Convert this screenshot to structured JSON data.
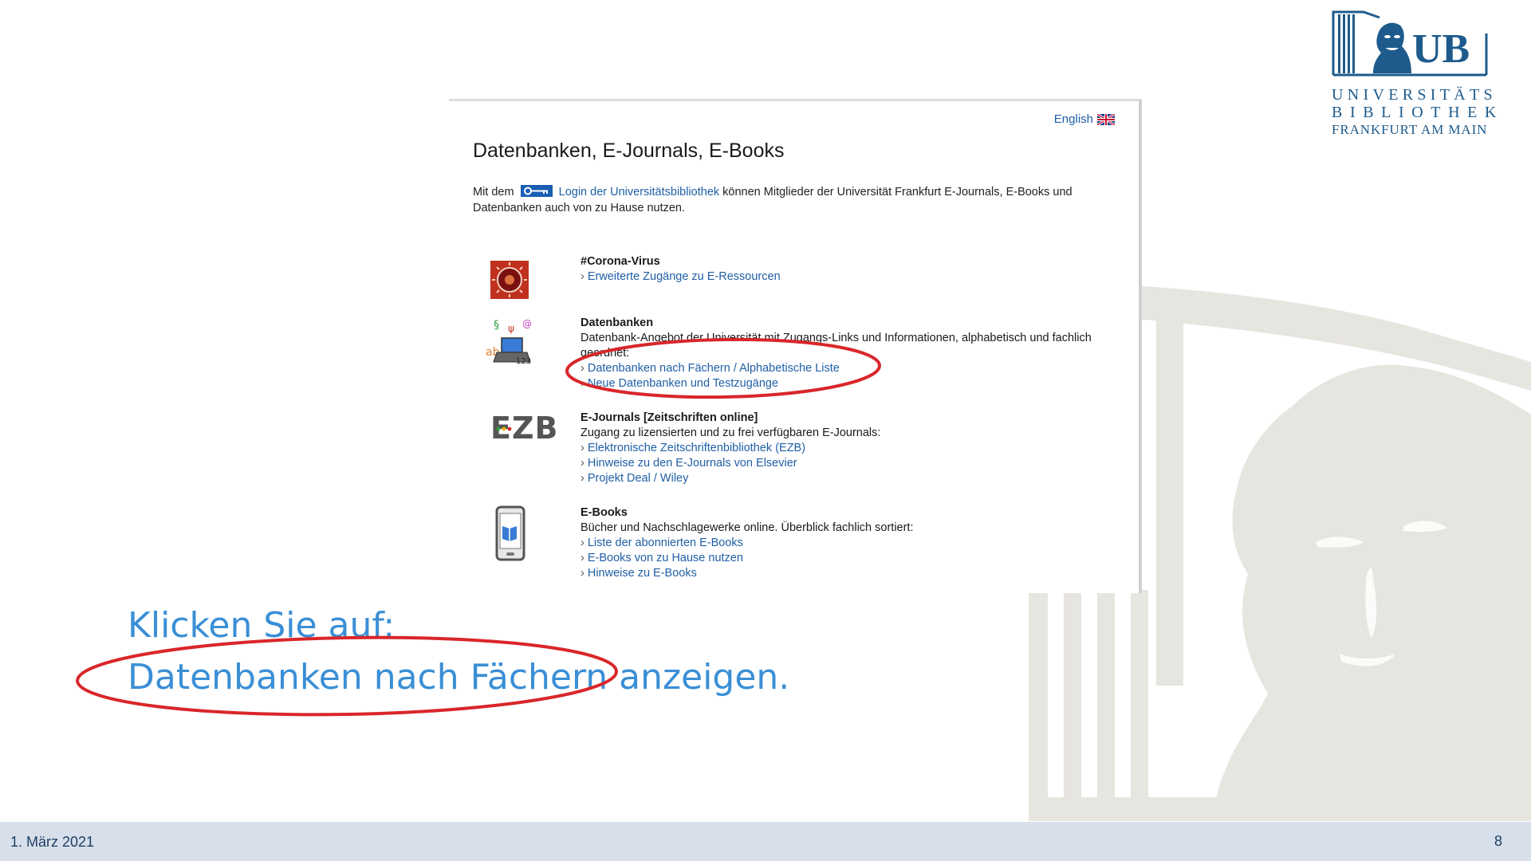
{
  "logo": {
    "letters": "UB",
    "line1": "UNIVERSITÄTS",
    "line2": "BIBLIOTHEK",
    "line3": "FRANKFURT AM MAIN"
  },
  "embedded_page": {
    "language_link": "English",
    "title": "Datenbanken, E-Journals, E-Books",
    "intro_prefix": "Mit dem",
    "intro_link": "Login der Universitätsbibliothek",
    "intro_suffix": "können Mitglieder der Universität Frankfurt E-Journals, E-Books und Datenbanken auch von zu Hause nutzen.",
    "sections": [
      {
        "heading": "#Corona-Virus",
        "icon": "corona-virus-icon",
        "links": [
          "Erweiterte Zugänge zu E-Ressourcen"
        ]
      },
      {
        "heading": "Datenbanken",
        "icon": "laptop-databases-icon",
        "description": "Datenbank-Angebot der Universität mit Zugangs-Links und Informationen, alphabetisch und fachlich geordnet:",
        "links": [
          "Datenbanken nach Fächern / Alphabetische Liste",
          "Neue Datenbanken und Testzugänge"
        ]
      },
      {
        "heading": "E-Journals [Zeitschriften online]",
        "icon": "ezb-logo-icon",
        "icon_text": "EZB",
        "description": "Zugang zu lizensierten und zu frei verfügbaren E-Journals:",
        "links": [
          "Elektronische Zeitschriftenbibliothek (EZB)",
          "Hinweise zu den E-Journals von Elsevier",
          "Projekt Deal / Wiley"
        ]
      },
      {
        "heading": "E-Books",
        "icon": "tablet-book-icon",
        "description": "Bücher und Nachschlagewerke online. Überblick fachlich sortiert:",
        "links": [
          "Liste der abonnierten E-Books",
          "E-Books von zu Hause nutzen",
          "Hinweise zu E-Books"
        ]
      }
    ]
  },
  "instruction": {
    "line1": "Klicken Sie auf:",
    "line2": "Datenbanken nach Fächern anzeigen."
  },
  "footer": {
    "date": "1. März 2021",
    "page_number": "8"
  },
  "colors": {
    "accent_blue": "#3a8fd6",
    "link_blue": "#1f5fa6",
    "annotation_red": "#d9262a",
    "footer_bg": "#d7e0ea",
    "logo_blue": "#1e5b8c"
  }
}
